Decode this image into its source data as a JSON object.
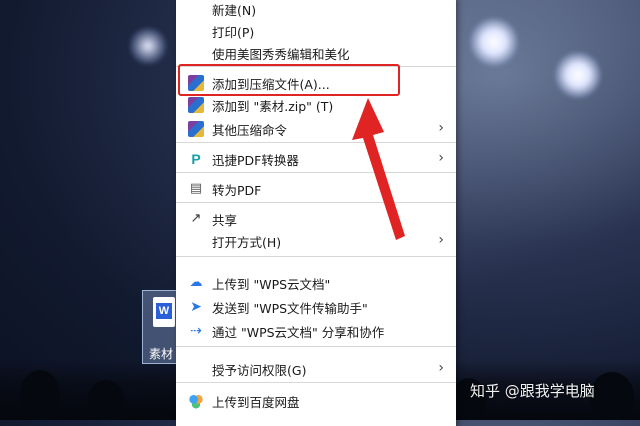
{
  "menu": {
    "items": [
      {
        "label": "新建(N)",
        "icon": "none"
      },
      {
        "label": "打印(P)",
        "icon": "none"
      },
      {
        "label": "使用美图秀秀编辑和美化",
        "icon": "none"
      },
      {
        "label": "添加到压缩文件(A)...",
        "icon": "winrar-icon"
      },
      {
        "label": "添加到 \"素材.zip\" (T)",
        "icon": "winrar-icon"
      },
      {
        "label": "其他压缩命令",
        "icon": "winrar-icon",
        "submenu": true
      },
      {
        "label": "迅捷PDF转换器",
        "icon": "pdf-converter-icon",
        "submenu": true
      },
      {
        "label": "转为PDF",
        "icon": "pdf-document-icon"
      },
      {
        "label": "共享",
        "icon": "share-icon"
      },
      {
        "label": "打开方式(H)",
        "icon": "none",
        "submenu": true
      },
      {
        "label": "上传到 \"WPS云文档\"",
        "icon": "cloud-upload-icon"
      },
      {
        "label": "发送到 \"WPS文件传输助手\"",
        "icon": "send-icon"
      },
      {
        "label": "通过 \"WPS云文档\" 分享和协作",
        "icon": "share-collab-icon"
      },
      {
        "label": "授予访问权限(G)",
        "icon": "none",
        "submenu": true
      },
      {
        "label": "上传到百度网盘",
        "icon": "baidu-netdisk-icon"
      }
    ],
    "submenu_arrow": "›"
  },
  "desktop": {
    "file_label": "素材",
    "file_icon_letter": "W"
  },
  "watermark": "知乎 @跟我学电脑",
  "colors": {
    "highlight": "#e02323",
    "menu_bg": "#ffffff"
  }
}
